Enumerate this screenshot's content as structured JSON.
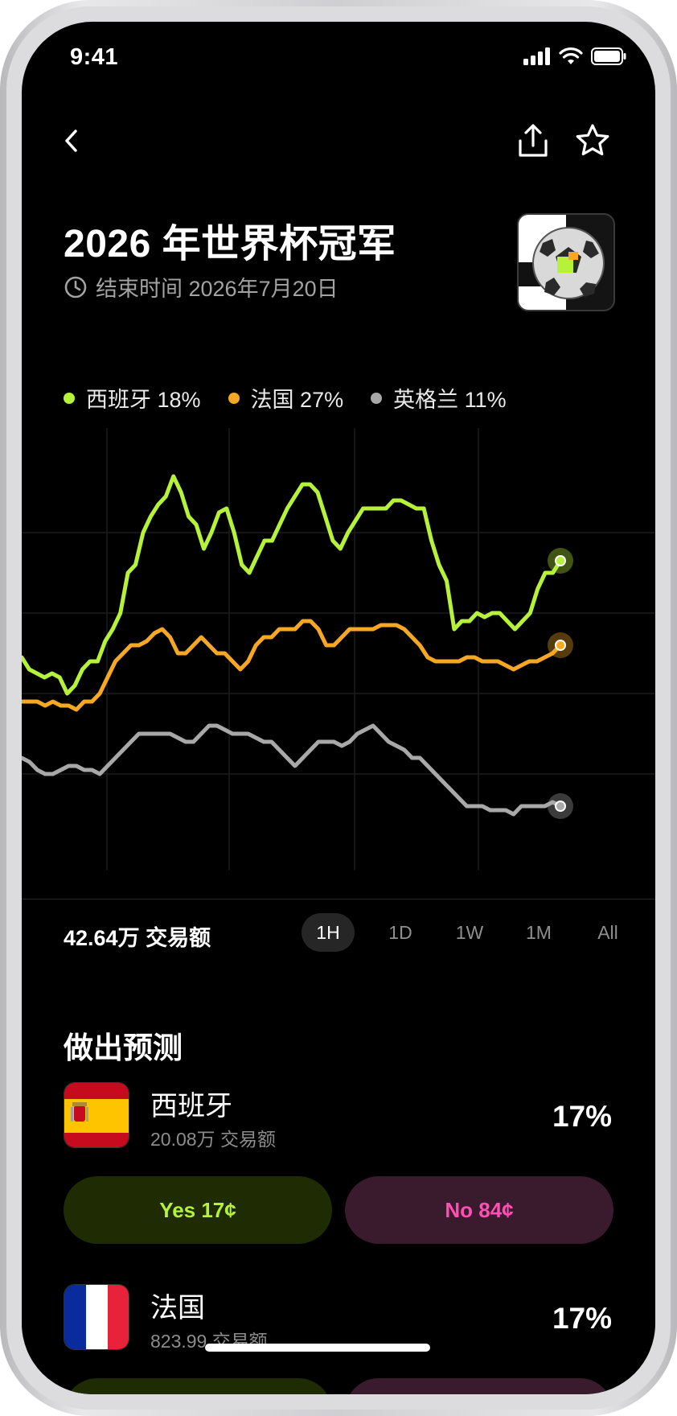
{
  "status_bar": {
    "time": "9:41"
  },
  "header": {
    "title": "2026 年世界杯冠军",
    "end_label": "结束时间 2026年7月20日"
  },
  "legend": [
    {
      "label": "西班牙 18%",
      "color": "#b6f23a"
    },
    {
      "label": "法国 27%",
      "color": "#f7a823"
    },
    {
      "label": "英格兰 11%",
      "color": "#a8a8a8"
    }
  ],
  "chart_data": {
    "type": "line",
    "grid": true,
    "ylim": [
      0,
      100
    ],
    "series": [
      {
        "name": "西班牙",
        "color": "#b6f23a",
        "values": [
          49,
          46,
          45,
          44,
          45,
          44,
          40,
          42,
          46,
          48,
          48,
          53,
          56,
          60,
          70,
          72,
          80,
          84,
          87,
          89,
          94,
          90,
          84,
          82,
          76,
          80,
          85,
          86,
          80,
          72,
          70,
          74,
          78,
          78,
          82,
          86,
          89,
          92,
          92,
          90,
          84,
          78,
          76,
          80,
          83,
          86,
          86,
          86,
          86,
          88,
          88,
          87,
          86,
          86,
          78,
          72,
          68,
          56,
          58,
          58,
          60,
          59,
          60,
          60,
          58,
          56,
          58,
          60,
          66,
          70,
          70,
          73
        ]
      },
      {
        "name": "法国",
        "color": "#f7a823",
        "values": [
          38,
          38,
          38,
          37,
          38,
          37,
          37,
          36,
          38,
          38,
          40,
          44,
          48,
          50,
          52,
          52,
          53,
          55,
          56,
          54,
          50,
          50,
          52,
          54,
          52,
          50,
          50,
          48,
          46,
          48,
          52,
          54,
          54,
          56,
          56,
          56,
          58,
          58,
          56,
          52,
          52,
          54,
          56,
          56,
          56,
          56,
          57,
          57,
          57,
          56,
          54,
          52,
          49,
          48,
          48,
          48,
          48,
          49,
          49,
          48,
          48,
          48,
          47,
          46,
          47,
          48,
          48,
          49,
          50,
          52
        ]
      },
      {
        "name": "英格兰",
        "color": "#a8a8a8",
        "values": [
          24,
          23,
          21,
          20,
          20,
          21,
          22,
          22,
          21,
          21,
          20,
          22,
          24,
          26,
          28,
          30,
          30,
          30,
          30,
          30,
          29,
          28,
          28,
          30,
          32,
          32,
          31,
          30,
          30,
          30,
          29,
          28,
          28,
          26,
          24,
          22,
          24,
          26,
          28,
          28,
          28,
          27,
          28,
          30,
          31,
          32,
          30,
          28,
          27,
          26,
          24,
          24,
          22,
          20,
          18,
          16,
          14,
          12,
          12,
          12,
          11,
          11,
          11,
          10,
          12,
          12,
          12,
          12,
          13,
          12
        ]
      }
    ]
  },
  "volume_label": "42.64万 交易额",
  "ranges": [
    "1H",
    "1D",
    "1W",
    "1M",
    "All"
  ],
  "section_title": "做出预测",
  "markets": [
    {
      "name": "西班牙",
      "volume": "20.08万 交易额",
      "pct": "17%",
      "yes": "Yes 17¢",
      "no": "No 84¢"
    },
    {
      "name": "法国",
      "volume": "823.99 交易额",
      "pct": "17%"
    }
  ]
}
